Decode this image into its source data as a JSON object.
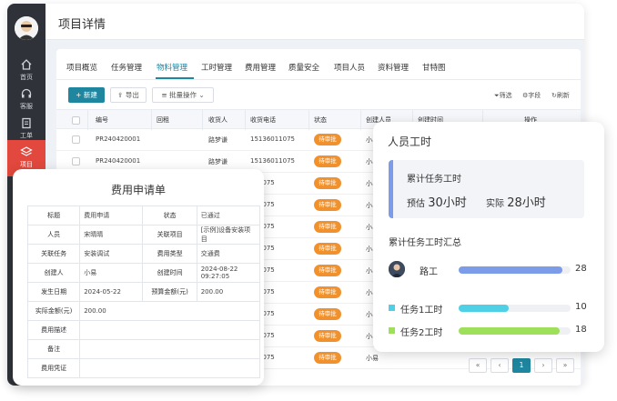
{
  "header": {
    "title": "项目详情"
  },
  "sidebar": {
    "items": [
      {
        "label": "首页",
        "icon": "home-icon"
      },
      {
        "label": "客服",
        "icon": "headset-icon"
      },
      {
        "label": "工单",
        "icon": "clipboard-icon"
      },
      {
        "label": "项目",
        "icon": "layers-icon",
        "active": true
      }
    ]
  },
  "tabs": [
    "项目概览",
    "任务管理",
    "物料管理",
    "工时管理",
    "费用管理",
    "质量安全",
    "项目人员",
    "资料管理",
    "甘特图"
  ],
  "active_tab": "物料管理",
  "toolbar": {
    "new_label": "新建",
    "export_label": "导出",
    "batch_label": "批量操作",
    "filter_label": "筛选",
    "fields_label": "字段",
    "refresh_label": "刷新"
  },
  "table": {
    "columns": [
      "编号",
      "回租",
      "收货人",
      "收货电话",
      "状态",
      "创建人员",
      "创建时间",
      "操作"
    ],
    "rows": [
      {
        "no": "PR240420001",
        "receiver": "路梦谦",
        "phone": "15136011075",
        "status": "待审批",
        "creator": "小易"
      },
      {
        "no": "PR240420001",
        "receiver": "路梦谦",
        "phone": "15136011075",
        "status": "待审批",
        "creator": "小易"
      },
      {
        "no": "",
        "receiver": "",
        "phone": "011075",
        "status": "待审批",
        "creator": "小易"
      },
      {
        "no": "",
        "receiver": "",
        "phone": "011075",
        "status": "待审批",
        "creator": "小易"
      },
      {
        "no": "",
        "receiver": "",
        "phone": "011075",
        "status": "待审批",
        "creator": "小易"
      },
      {
        "no": "",
        "receiver": "",
        "phone": "011075",
        "status": "待审批",
        "creator": "小易"
      },
      {
        "no": "",
        "receiver": "",
        "phone": "011075",
        "status": "待审批",
        "creator": "小易"
      },
      {
        "no": "",
        "receiver": "",
        "phone": "011075",
        "status": "待审批",
        "creator": "小易"
      },
      {
        "no": "",
        "receiver": "",
        "phone": "011075",
        "status": "待审批",
        "creator": "小易"
      },
      {
        "no": "",
        "receiver": "",
        "phone": "011075",
        "status": "待审批",
        "creator": "小易"
      },
      {
        "no": "",
        "receiver": "",
        "phone": "011075",
        "status": "待审批",
        "creator": "小易"
      }
    ]
  },
  "pager": {
    "first": "«",
    "prev": "‹",
    "current": "1",
    "next": "›",
    "last": "»"
  },
  "expense": {
    "title": "费用申请单",
    "rows": [
      {
        "l1": "标题",
        "v1": "费用申请",
        "l2": "状态",
        "v2": "已通过"
      },
      {
        "l1": "人员",
        "v1": "宋晴晴",
        "l2": "关联项目",
        "v2": "[示例]设备安装项目"
      },
      {
        "l1": "关联任务",
        "v1": "安装调试",
        "l2": "费用类型",
        "v2": "交通费"
      },
      {
        "l1": "创建人",
        "v1": "小易",
        "l2": "创建时间",
        "v2": "2024-08-22 09:27:05"
      },
      {
        "l1": "发生日期",
        "v1": "2024-05-22",
        "l2": "预算金额(元)",
        "v2": "200.00"
      },
      {
        "l1": "实际金额(元)",
        "v1": "200.00"
      },
      {
        "l1": "费用描述",
        "v1": ""
      },
      {
        "l1": "备注",
        "v1": ""
      },
      {
        "l1": "费用凭证",
        "v1": ""
      }
    ]
  },
  "hours": {
    "title": "人员工时",
    "summary_title": "累计任务工时",
    "estimated_label": "预估",
    "estimated_value": "30小时",
    "actual_label": "实际",
    "actual_value": "28小时",
    "section_title": "累计任务工时汇总",
    "items": [
      {
        "name": "路工",
        "value": 28,
        "display": "28",
        "fraction": 0.93,
        "color": "#7c9be9"
      },
      {
        "name": "任务1工时",
        "value": 10,
        "display": "10",
        "fraction": 0.45,
        "color": "#4fd0e6"
      },
      {
        "name": "任务2工时",
        "value": 18,
        "display": "18",
        "fraction": 0.9,
        "color": "#9fe05a"
      }
    ]
  }
}
